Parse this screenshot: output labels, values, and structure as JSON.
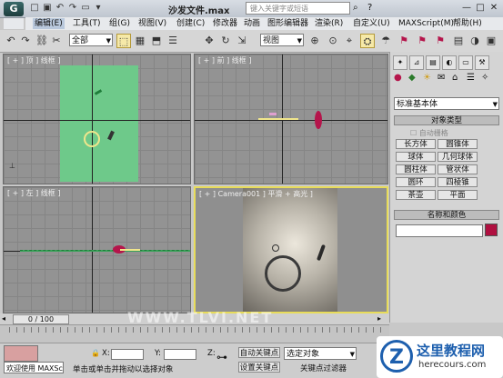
{
  "titlebar": {
    "logo": "G",
    "quick_access": [
      "□",
      "▣",
      "↶",
      "↷",
      "▭",
      "▾"
    ],
    "title": "沙发文件.max",
    "search_placeholder": "键入关键字或短语",
    "window_buttons": [
      "—",
      "□",
      "✕"
    ]
  },
  "menu": [
    "编辑(E)",
    "工具(T)",
    "组(G)",
    "视图(V)",
    "创建(C)",
    "修改器",
    "动画",
    "图形编辑器",
    "渲染(R)",
    "自定义(U)",
    "MAXScript(M)",
    "帮助(H)"
  ],
  "toolbar": {
    "filter_value": "全部",
    "view_value": "视图",
    "icons": [
      "↶",
      "↷",
      "⛓",
      "✂",
      "◌",
      "⬚",
      "▦",
      "⬒",
      "☰",
      "✥",
      "↻",
      "⇲",
      "⊕",
      "⊙",
      "⌖",
      "⛭",
      "☂",
      "⚑",
      "⚑",
      "⚑",
      "▤",
      "◑",
      "▣"
    ]
  },
  "viewports": {
    "top": "[ + ] 顶 ] 线框 ]",
    "front": "[ + ] 前 ] 线框 ]",
    "left": "[ + ] 左 ] 线框 ]",
    "camera": "[ + ] Camera001 ] 平滑 + 高光 ]"
  },
  "command_panel": {
    "tabs": [
      "✦",
      "⊿",
      "▤",
      "◐",
      "▭",
      "⚒"
    ],
    "subtabs": [
      "●",
      "◆",
      "☀",
      "✉",
      "⌂",
      "☰",
      "✧"
    ],
    "category": "标准基本体",
    "rollout_object_type": "对象类型",
    "auto_grid": "自动栅格",
    "buttons": [
      [
        "长方体",
        "圆锥体"
      ],
      [
        "球体",
        "几何球体"
      ],
      [
        "圆柱体",
        "管状体"
      ],
      [
        "圆环",
        "四棱锥"
      ],
      [
        "茶壶",
        "平面"
      ]
    ],
    "rollout_name_color": "名称和颜色",
    "name_value": "",
    "object_color": "#b01040"
  },
  "timeline": {
    "frame_counter": "0 / 100",
    "ruler_ticks": [
      "0",
      "10",
      "20",
      "30",
      "40",
      "50",
      "60",
      "70",
      "80",
      "90",
      "100"
    ]
  },
  "status": {
    "maxscript_label": "欢迎使用 MAXSc",
    "prompt": "单击或单击并拖动以选择对象",
    "x_label": "X:",
    "y_label": "Y:",
    "z_label": "Z:",
    "auto_key": "自动关键点",
    "set_key": "设置关键点",
    "selection_set": "选定对象",
    "key_filters": "关键点过滤器"
  },
  "watermarks": {
    "logo_text": "这里教程网",
    "logo_url": "herecours.com",
    "site_overlay": "WWW.TLVI.NET"
  },
  "colors": {
    "selection_green": "#6ec98a",
    "highlight_yellow": "#f0e68c",
    "active_border": "#e8dc5a",
    "accent_red": "#b5154b"
  }
}
